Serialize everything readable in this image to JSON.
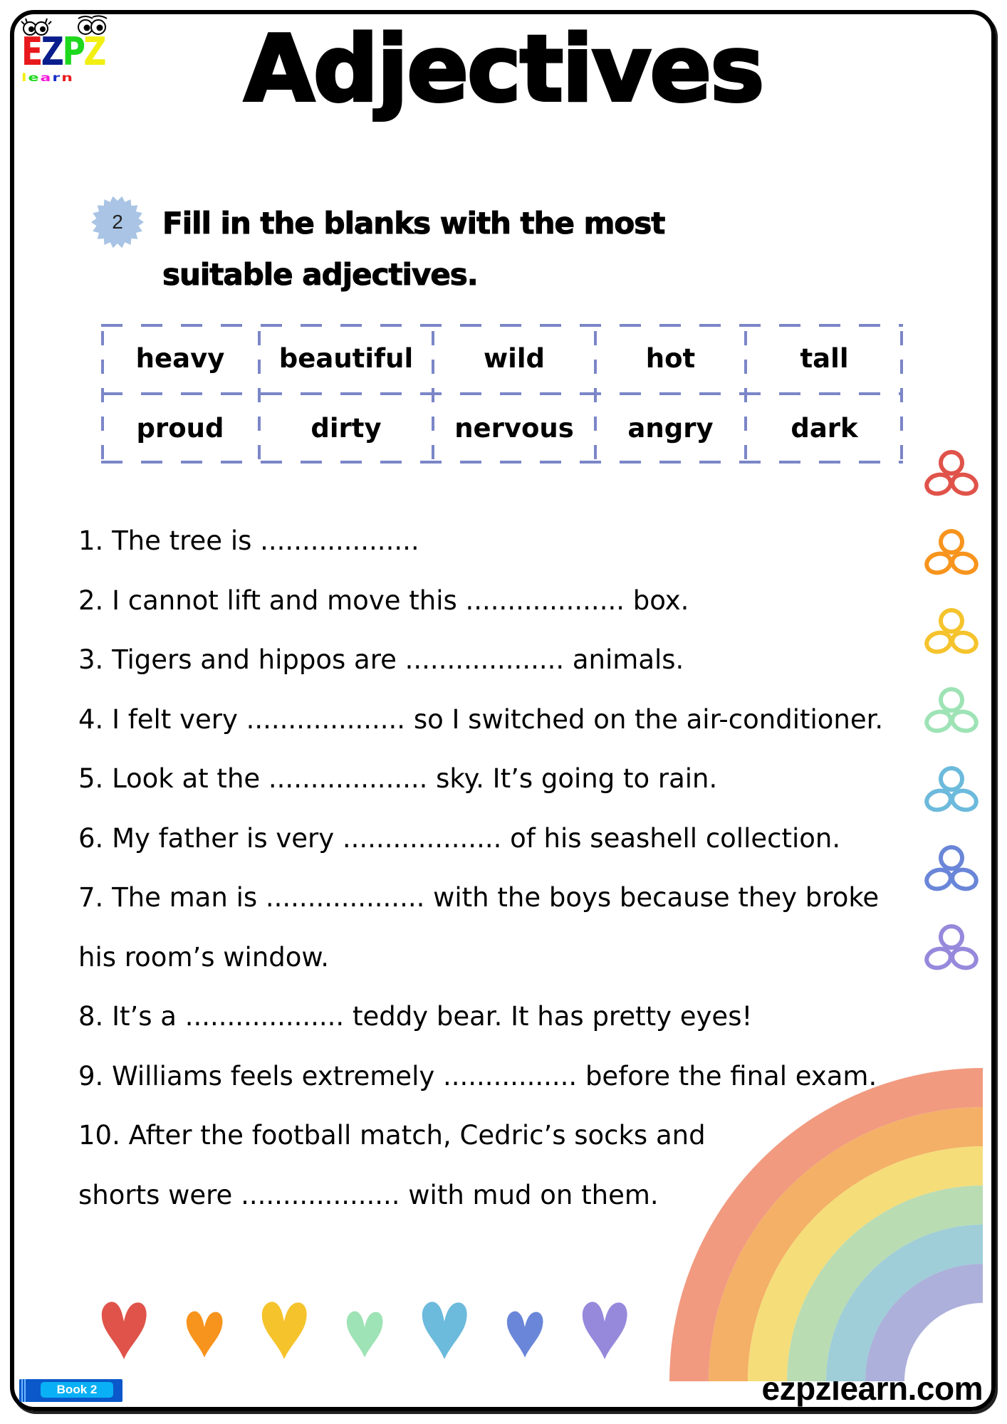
{
  "logo": {
    "letters": [
      "E",
      "Z",
      "P",
      "Z"
    ],
    "letter_colors": [
      "#e8191c",
      "#0a1d8c",
      "#1ed81e",
      "#f2ef12"
    ],
    "subtitle": "learn",
    "subtitle_colors": [
      "#f2ef12",
      "#1ed81e",
      "#f21ad8",
      "#1a2ec8",
      "#e8191c"
    ]
  },
  "title": "Adjectives",
  "exercise": {
    "number": "2",
    "badge_color": "#a9c4e4",
    "instruction": "Fill in the blanks with the most suitable adjectives."
  },
  "word_bank": {
    "border_color": "#7b86c8",
    "rows": [
      [
        "heavy",
        "beautiful",
        "wild",
        "hot",
        "tall"
      ],
      [
        "proud",
        "dirty",
        "nervous",
        "angry",
        "dark"
      ]
    ]
  },
  "sentences": [
    "1. The tree is ...................",
    "2. I cannot lift and move this ................... box.",
    "3. Tigers and hippos are ................... animals.",
    "4. I felt very ................... so I switched on the air-conditioner.",
    "5. Look at the ................... sky. It’s going to rain.",
    "6. My father is very  ................... of his seashell collection.",
    "7. The man is ................... with the boys because they broke",
    "his room’s window.",
    "8. It’s a ................... teddy bear. It has pretty eyes!",
    "9. Williams feels extremely ................ before the final exam.",
    "10. After the football match, Cedric’s socks and",
    "shorts were ................... with mud on them."
  ],
  "decor": {
    "flower_colors": [
      "#e0534a",
      "#f7941d",
      "#f5c32c",
      "#9ee3b5",
      "#6cbadc",
      "#6a86d8",
      "#9689dc"
    ],
    "heart_colors": [
      "#e0534a",
      "#f7941d",
      "#f5c32c",
      "#9ee3b5",
      "#6cbadc",
      "#6a86d8",
      "#9689dc"
    ],
    "rainbow_colors": [
      "#f19a80",
      "#f4b067",
      "#f5dd7a",
      "#b9dcb3",
      "#9fcdd8",
      "#acb0da"
    ]
  },
  "footer": {
    "book_label": "Book 2",
    "website": "ezpzlearn.com"
  }
}
